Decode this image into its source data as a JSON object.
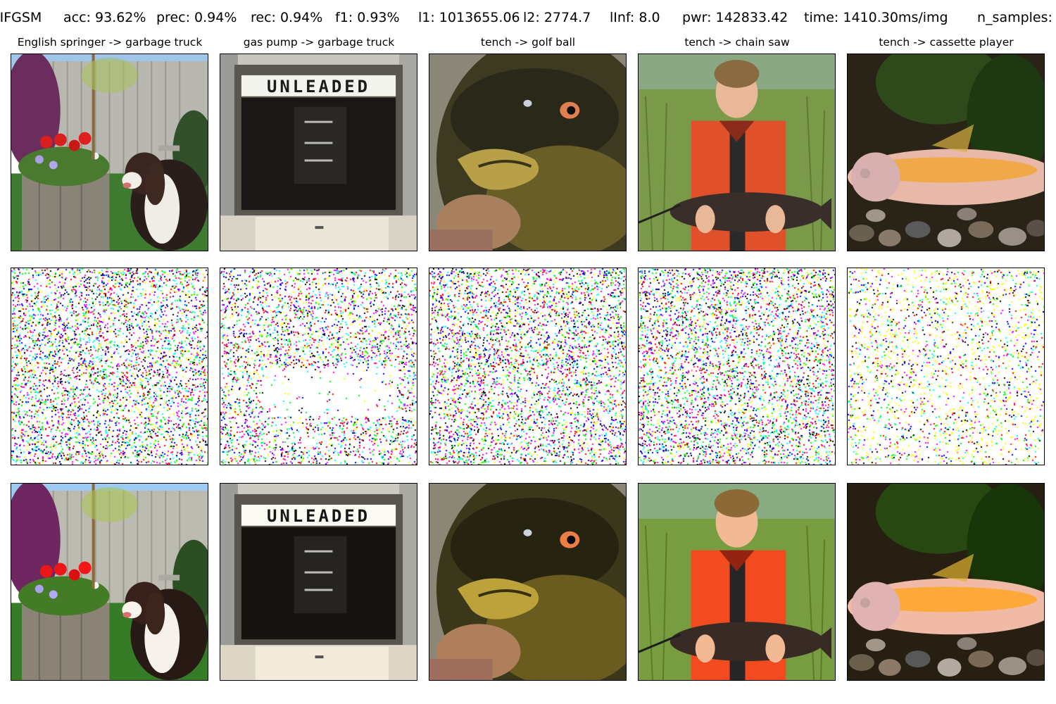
{
  "header": {
    "attack": "IIFGSM",
    "acc": "acc: 93.62%",
    "prec": "prec: 0.94%",
    "rec": "rec: 0.94%",
    "f1": "f1: 0.93%",
    "l1": "l1: 1013655.06",
    "l2": "l2: 2774.7",
    "linf": "lInf: 8.0",
    "pwr": "pwr: 142833.42",
    "time": "time: 1410.30ms/img",
    "n_samples": "n_samples:"
  },
  "columns": [
    {
      "title": "English springer -> garbage truck",
      "subject": "springer-spaniel-dog"
    },
    {
      "title": "gas pump -> garbage truck",
      "subject": "gas-pump",
      "sign_text": "UNLEADED"
    },
    {
      "title": "tench -> golf ball",
      "subject": "tench-fish-closeup"
    },
    {
      "title": "tench -> chain saw",
      "subject": "boy-holding-tench"
    },
    {
      "title": "tench -> cassette player",
      "subject": "goldfish-on-pebbles"
    }
  ],
  "noise_palette": [
    "#ff00ff",
    "#00ffff",
    "#ffff00",
    "#ff0000",
    "#0000ff",
    "#00ff00",
    "#000000"
  ]
}
